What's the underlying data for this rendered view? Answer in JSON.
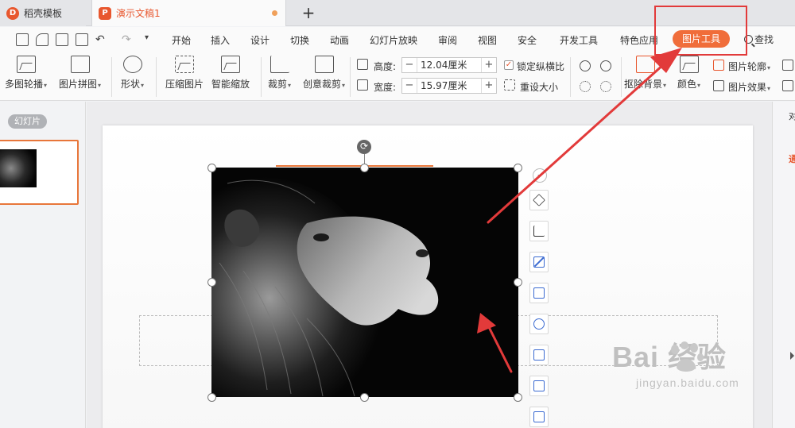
{
  "tabs": {
    "home": "稻壳模板",
    "doc": "演示文稿1",
    "new_tab": "+"
  },
  "menu": {
    "items": [
      "开始",
      "插入",
      "设计",
      "切换",
      "动画",
      "幻灯片放映",
      "审阅",
      "视图",
      "安全",
      "开发工具",
      "特色应用"
    ],
    "active": "图片工具",
    "find": "查找"
  },
  "ribbon": {
    "multi_outline": "多图轮播",
    "puzzle": "图片拼图",
    "shape": "形状",
    "compress": "压缩图片",
    "smart_scale": "智能缩放",
    "crop": "裁剪",
    "creative_crop": "创意裁剪",
    "height_label": "高度:",
    "height_value": "12.04厘米",
    "width_label": "宽度:",
    "width_value": "15.97厘米",
    "lock_ratio": "锁定纵横比",
    "reset_size": "重设大小",
    "remove_bg": "抠除背景",
    "color": "颜色",
    "outline": "图片轮廓",
    "effects": "图片效果",
    "minus": "−",
    "plus": "+",
    "check": "✓",
    "caret": "▾"
  },
  "left_panel": {
    "section": "幻灯片"
  },
  "right_panel": {
    "char1": "对",
    "char2": "通"
  },
  "watermark": {
    "main": "Bai  经验",
    "sub": "jingyan.baidu.com"
  },
  "colors": {
    "accent": "#e8572e",
    "active_tab": "#f06d3a",
    "annotation_red": "#e23a3a",
    "tool_blue": "#3c6bd1"
  }
}
